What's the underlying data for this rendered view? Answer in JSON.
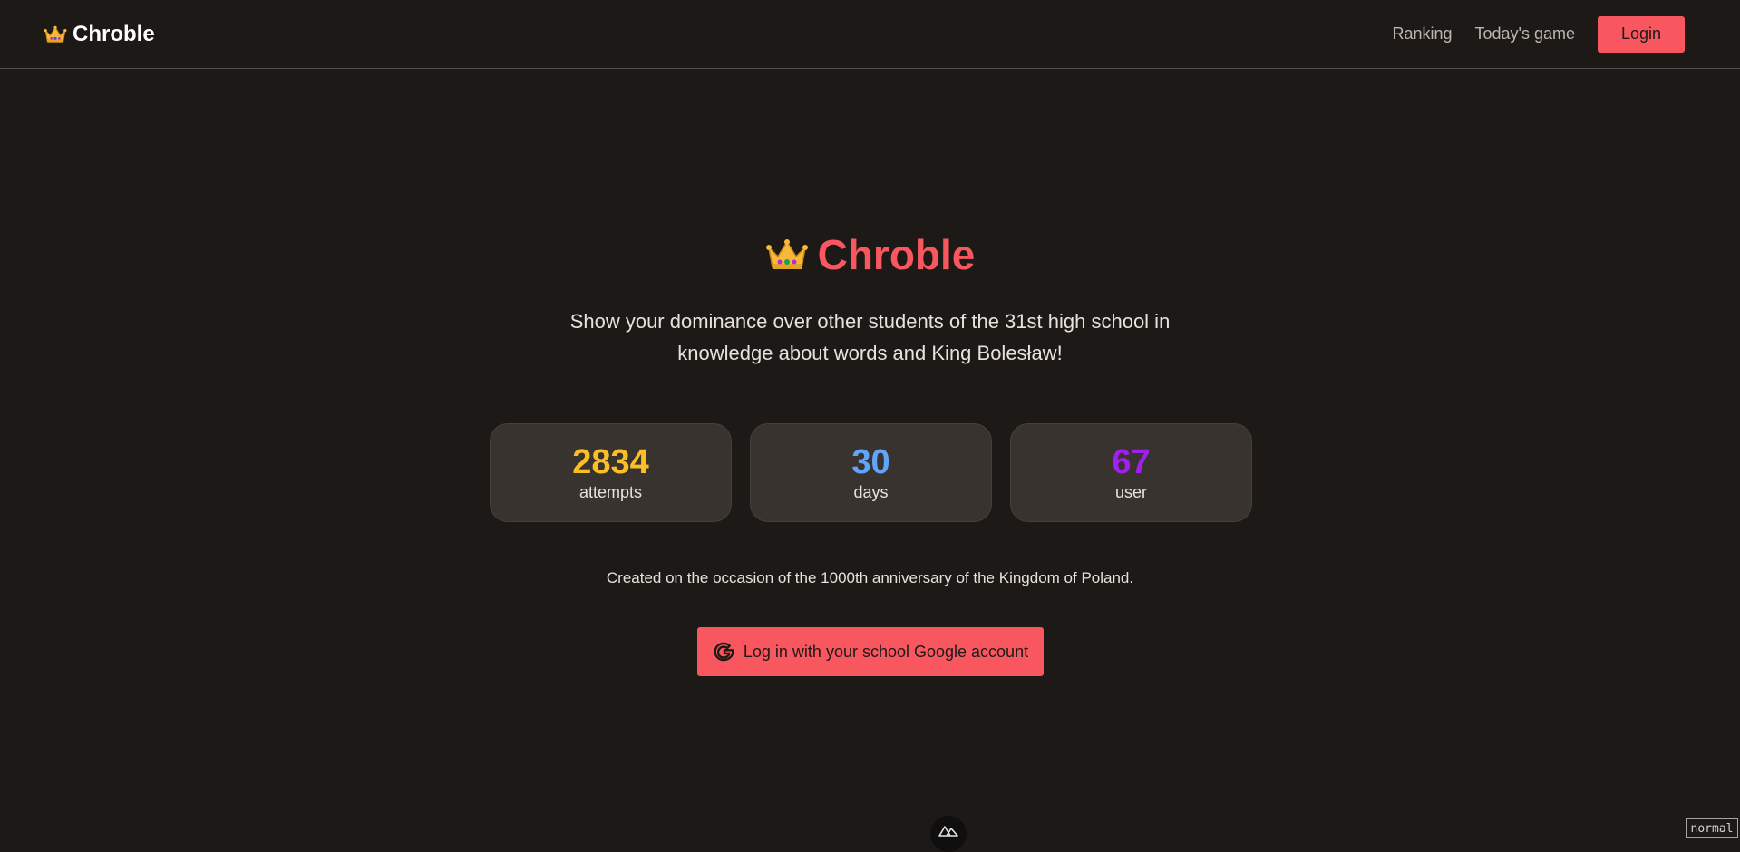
{
  "navbar": {
    "brand": "Chroble",
    "brand_icon": "crown-icon",
    "links": [
      "Ranking",
      "Today's game"
    ],
    "login_label": "Login"
  },
  "hero": {
    "title": "Chroble",
    "title_icon": "crown-icon",
    "subtitle_line1": "Show your dominance over other students of the 31st high school in",
    "subtitle_line2": "knowledge about words and King Bolesław!"
  },
  "stats": [
    {
      "value": "2834",
      "label": "attempts",
      "color": "#fbbf24"
    },
    {
      "value": "30",
      "label": "days",
      "color": "#60a5fa"
    },
    {
      "value": "67",
      "label": "user",
      "color": "#a020f0"
    }
  ],
  "occasion": "Created on the occasion of the 1000th anniversary of the Kingdom of Poland.",
  "google_button": {
    "label": "Log in with your school Google account",
    "icon": "google-g-icon"
  },
  "footer": {
    "badge_icon": "nuxt-icon",
    "mode_label": "normal"
  },
  "colors": {
    "accent": "#f9575f",
    "background": "#1d1917",
    "card": "#38332e"
  }
}
